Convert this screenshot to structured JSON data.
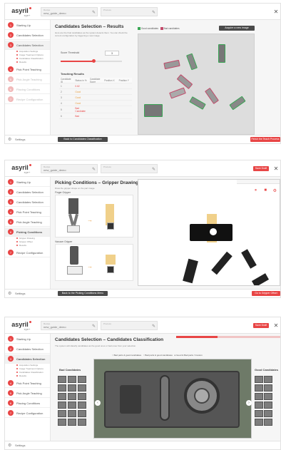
{
  "app": {
    "logo": "asyril",
    "logo_sub": "eye+"
  },
  "screen1": {
    "field1_label": "Recipe",
    "field1_value": "new_guide_demo",
    "field2_label": "Process",
    "sidebar": [
      "Starting Up",
      "Candidates Selection",
      "Candidates Selection",
      "Pick Point Teaching",
      "Pick Angle Teaching",
      "Placing Conditions",
      "Recipe Configuration"
    ],
    "sub_items": [
      "Acquisition Settings",
      "Image Treatment Options",
      "Candidates Classification",
      "Results"
    ],
    "title": "Candidates Selection – Results",
    "description": "Here are the final candidates as the system detects them. You can check the current configuration by triggering a new image.",
    "score_label": "Score Threshold",
    "score_value": "3",
    "legend_good": "Good candidates",
    "legend_bad": "Bad candidates",
    "acquire_btn": "Acquire a new image",
    "table_title": "Teaching Results",
    "table_headers": [
      "Candidate ID",
      "Status in %",
      "Candidate Score",
      "Position X",
      "Position Y"
    ],
    "table_rows": [
      [
        "1",
        "0.62",
        "",
        "",
        ""
      ],
      [
        "2",
        "Good",
        "",
        "",
        ""
      ],
      [
        "3",
        "Good",
        "",
        "",
        ""
      ],
      [
        "4",
        "Good",
        "",
        "",
        ""
      ],
      [
        "5",
        "Bad Candidate",
        "",
        "",
        ""
      ],
      [
        "6",
        "Bad",
        "",
        "",
        ""
      ]
    ],
    "back_btn": "Back to Candidates Classification",
    "next_btn": "Finish the Teach Process",
    "footer": "Settings"
  },
  "screen2": {
    "field1_label": "Recipe",
    "field1_value": "new_guide_demo",
    "field2_label": "Process",
    "sidebar": [
      "Starting Up",
      "Candidates Selection",
      "Candidates Selection",
      "Pick Point Teaching",
      "Pick Angle Teaching",
      "Picking Conditions",
      "Recipe Configuration"
    ],
    "sub_items": [
      "Gripper Drawing",
      "Gripper Offset",
      "Results"
    ],
    "title": "Picking Conditions – Gripper Drawing",
    "description": "Draw the gripper shape on the part image.",
    "label_a": "Finger Gripper",
    "label_b": "Vacuum Gripper",
    "top_btn": "Save Draft",
    "back_btn": "Back to the Picking Conditions Menu",
    "next_btn": "Go to Gripper Offset",
    "footer": "Settings"
  },
  "screen3": {
    "field1_label": "Recipe",
    "field1_value": "new_guide_demo",
    "field2_label": "Process",
    "sidebar": [
      "Starting Up",
      "Candidates Selection",
      "Candidates Selection",
      "Pick Point Teaching",
      "Pick Angle Teaching",
      "Placing Conditions",
      "Recipe Configuration"
    ],
    "sub_items": [
      "Acquisition Settings",
      "Image Treatment Options",
      "Candidates Classification",
      "Results"
    ],
    "title": "Candidates Selection – Candidates Classification",
    "description": "The system will classify candidates as the good ones or bad ones from your selection.",
    "top_btn": "Save Draft",
    "bad_title": "Bad Candidates",
    "good_title": "Good Candidates",
    "opt1": "Bad parts & good candidates",
    "opt2": "Bad parts & good candidates",
    "opt3": "Good & Bad parts / Custom",
    "footer": "Settings"
  }
}
